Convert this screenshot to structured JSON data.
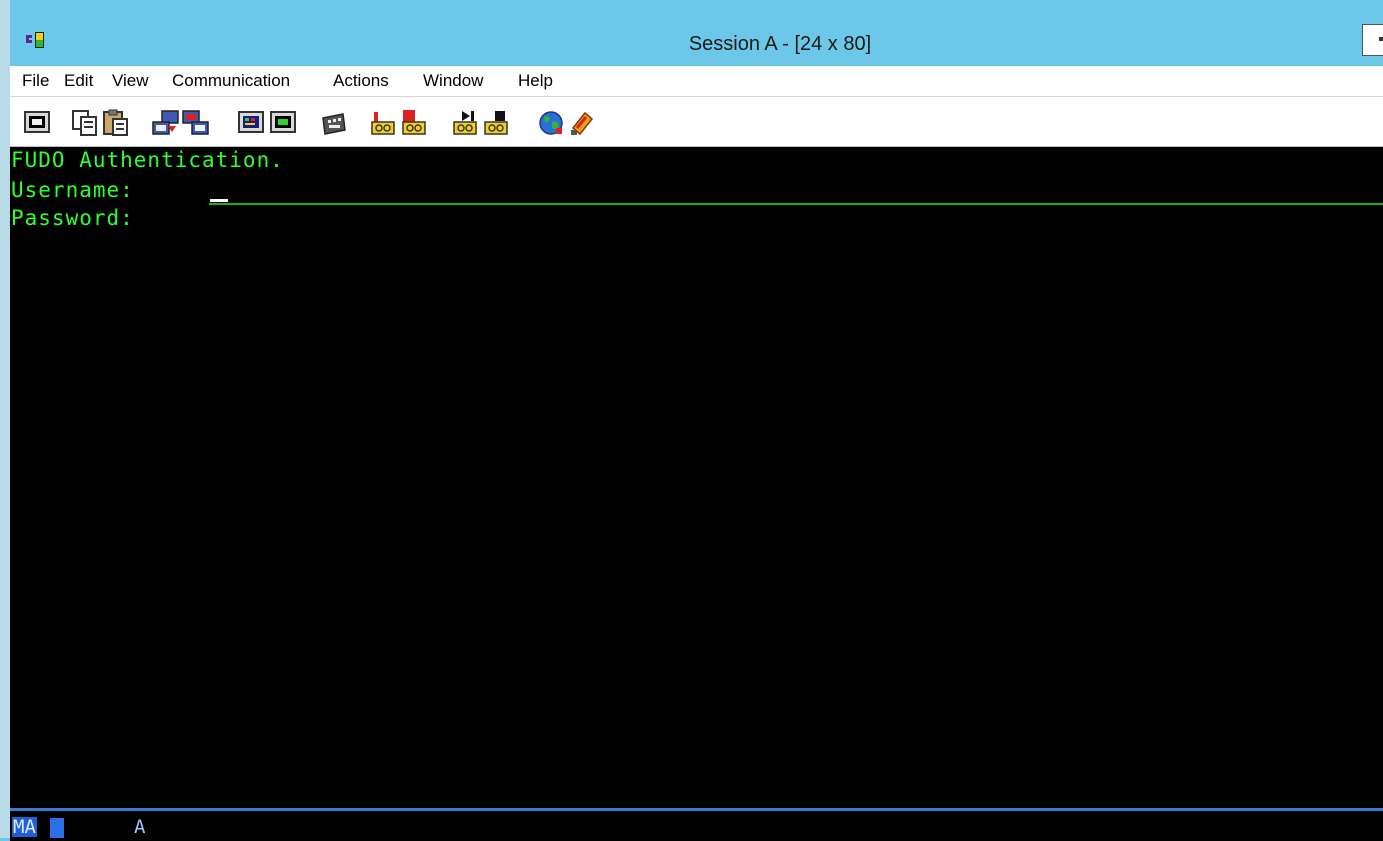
{
  "window": {
    "title": "Session A - [24 x 80]"
  },
  "menubar": {
    "items": [
      "File",
      "Edit",
      "View",
      "Communication",
      "Actions",
      "Window",
      "Help"
    ]
  },
  "toolbar": {
    "buttons": [
      {
        "icon": "print-screen-icon"
      },
      {
        "icon": "copy-icon"
      },
      {
        "icon": "paste-icon"
      },
      {
        "icon": "send-file-icon"
      },
      {
        "icon": "receive-file-icon"
      },
      {
        "icon": "display-setup-icon"
      },
      {
        "icon": "color-palette-icon"
      },
      {
        "icon": "keyboard-map-icon"
      },
      {
        "icon": "record-macro-icon"
      },
      {
        "icon": "stop-macro-icon"
      },
      {
        "icon": "play-macro-icon"
      },
      {
        "icon": "macro-options-icon"
      },
      {
        "icon": "globe-icon"
      },
      {
        "icon": "help-icon"
      }
    ]
  },
  "terminal": {
    "line1": "FUDO Authentication.",
    "username_label": "Username:",
    "password_label": "Password:",
    "username_value": ""
  },
  "status_line": {
    "mode": "MA",
    "indicator": "A"
  },
  "colors": {
    "titlebar": "#6cc7e8",
    "terminal_bg": "#000000",
    "terminal_text": "#2fff2f",
    "status_accent": "#3a7bd5"
  }
}
